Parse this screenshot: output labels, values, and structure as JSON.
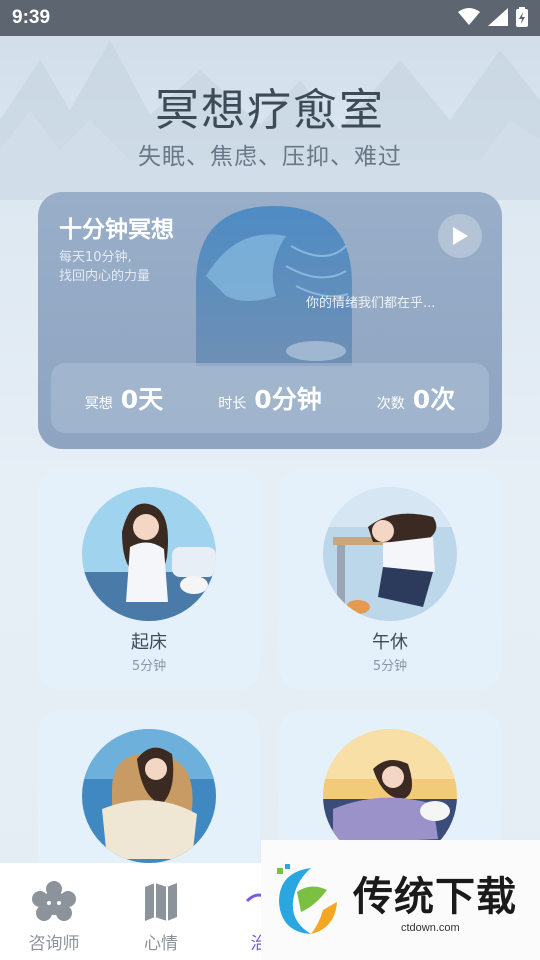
{
  "status_bar": {
    "time": "9:39"
  },
  "header": {
    "title": "冥想疗愈室",
    "subtitle": "失眠、焦虑、压抑、难过"
  },
  "hero": {
    "title": "十分钟冥想",
    "desc_line1": "每天10分钟,",
    "desc_line2": "找回内心的力量",
    "quote": "你的情绪我们都在乎...",
    "stats": [
      {
        "label": "冥想",
        "value": "0天"
      },
      {
        "label": "时长",
        "value": "0分钟"
      },
      {
        "label": "次数",
        "value": "0次"
      }
    ]
  },
  "cards": [
    {
      "name": "起床",
      "duration": "5分钟"
    },
    {
      "name": "午休",
      "duration": "5分钟"
    },
    {
      "name": "",
      "duration": ""
    },
    {
      "name": "",
      "duration": ""
    }
  ],
  "nav": {
    "items": [
      {
        "label": "咨询师",
        "icon": "flower-face-icon"
      },
      {
        "label": "心情",
        "icon": "map-icon"
      },
      {
        "label": "治",
        "icon": "heal-icon"
      }
    ]
  },
  "watermark": {
    "brand": "传统下载",
    "url": "ctdown.com"
  },
  "colors": {
    "accent": "#7b5be0",
    "hero_bg": "#8ea4c0",
    "card_bg": "#e4f0fa"
  }
}
